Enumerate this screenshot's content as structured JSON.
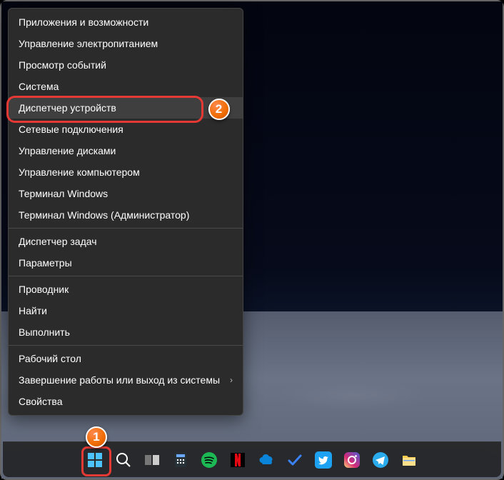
{
  "menu": {
    "groups": [
      [
        {
          "label": "Приложения и возможности",
          "highlighted": false
        },
        {
          "label": "Управление электропитанием",
          "highlighted": false
        },
        {
          "label": "Просмотр событий",
          "highlighted": false
        },
        {
          "label": "Система",
          "highlighted": false
        },
        {
          "label": "Диспетчер устройств",
          "highlighted": true
        },
        {
          "label": "Сетевые подключения",
          "highlighted": false
        },
        {
          "label": "Управление дисками",
          "highlighted": false
        },
        {
          "label": "Управление компьютером",
          "highlighted": false
        },
        {
          "label": "Терминал Windows",
          "highlighted": false
        },
        {
          "label": "Терминал Windows (Администратор)",
          "highlighted": false
        }
      ],
      [
        {
          "label": "Диспетчер задач",
          "highlighted": false
        },
        {
          "label": "Параметры",
          "highlighted": false
        }
      ],
      [
        {
          "label": "Проводник",
          "highlighted": false
        },
        {
          "label": "Найти",
          "highlighted": false
        },
        {
          "label": "Выполнить",
          "highlighted": false
        }
      ],
      [
        {
          "label": "Рабочий стол",
          "highlighted": false
        },
        {
          "label": "Завершение работы или выход из системы",
          "highlighted": false,
          "submenu": true
        },
        {
          "label": "Свойства",
          "highlighted": false
        }
      ]
    ]
  },
  "badges": {
    "b1": "1",
    "b2": "2"
  },
  "taskbar": {
    "icons": [
      {
        "name": "start-icon",
        "color": "#4cc2ff"
      },
      {
        "name": "search-icon",
        "color": "#ffffff"
      },
      {
        "name": "taskview-icon",
        "color": "#ffffff"
      },
      {
        "name": "calculator-icon",
        "color": "#6aa9ff"
      },
      {
        "name": "spotify-icon",
        "color": "#1db954"
      },
      {
        "name": "netflix-icon",
        "color": "#e50914"
      },
      {
        "name": "onedrive-icon",
        "color": "#0a84d8"
      },
      {
        "name": "todo-icon",
        "color": "#3b82f6"
      },
      {
        "name": "twitter-icon",
        "color": "#1da1f2"
      },
      {
        "name": "instagram-icon",
        "color": "#e1306c"
      },
      {
        "name": "telegram-icon",
        "color": "#2aabee"
      },
      {
        "name": "explorer-icon",
        "color": "#ffcc4d"
      }
    ]
  }
}
